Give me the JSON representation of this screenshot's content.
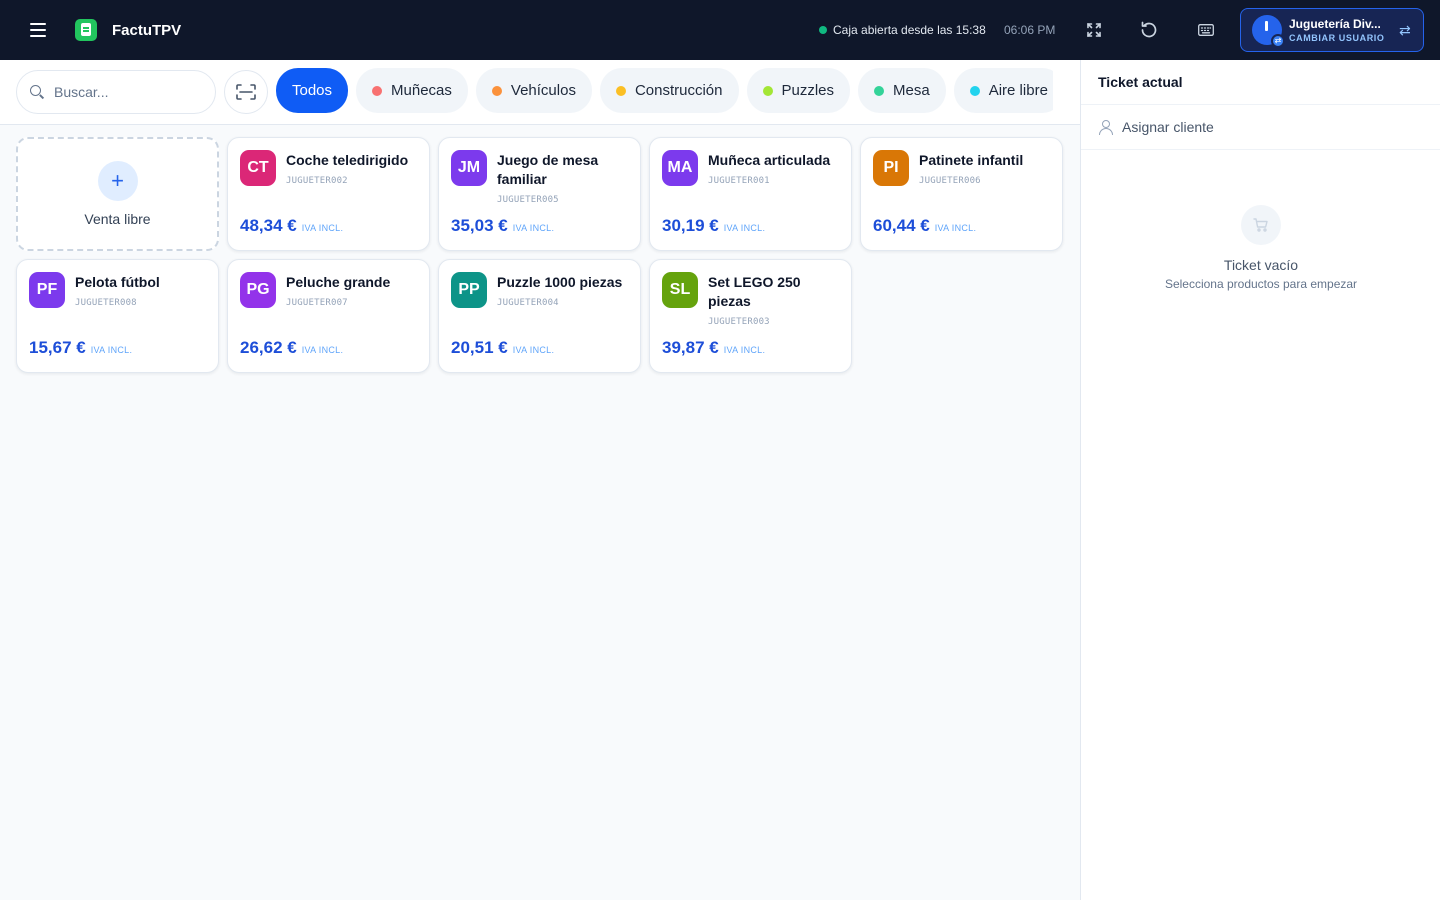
{
  "header": {
    "app_title": "FactuTPV",
    "status_text": "Caja abierta desde las 15:38",
    "clock": "06:06 PM",
    "user_name": "Juguetería Div...",
    "user_action": "CAMBIAR USUARIO",
    "icons": [
      "menu-icon",
      "fullscreen-icon",
      "refresh-icon",
      "keyboard-icon",
      "swap-icon"
    ]
  },
  "search": {
    "placeholder": "Buscar..."
  },
  "categories": [
    {
      "label": "Todos",
      "active": true,
      "color": ""
    },
    {
      "label": "Muñecas",
      "active": false,
      "color": "#f87171"
    },
    {
      "label": "Vehículos",
      "active": false,
      "color": "#fb923c"
    },
    {
      "label": "Construcción",
      "active": false,
      "color": "#fbbf24"
    },
    {
      "label": "Puzzles",
      "active": false,
      "color": "#a3e635"
    },
    {
      "label": "Mesa",
      "active": false,
      "color": "#34d399"
    },
    {
      "label": "Aire libre",
      "active": false,
      "color": "#22d3ee"
    }
  ],
  "free_sale": {
    "label": "Venta libre"
  },
  "products": [
    {
      "initials": "CT",
      "name": "Coche teledirigido",
      "code": "JUGUETER002",
      "price": "48,34 €",
      "tax": "IVA INCL.",
      "color": "#db2777"
    },
    {
      "initials": "JM",
      "name": "Juego de mesa familiar",
      "code": "JUGUETER005",
      "price": "35,03 €",
      "tax": "IVA INCL.",
      "color": "#7c3aed"
    },
    {
      "initials": "MA",
      "name": "Muñeca articulada",
      "code": "JUGUETER001",
      "price": "30,19 €",
      "tax": "IVA INCL.",
      "color": "#7c3aed"
    },
    {
      "initials": "PI",
      "name": "Patinete infantil",
      "code": "JUGUETER006",
      "price": "60,44 €",
      "tax": "IVA INCL.",
      "color": "#d97706"
    },
    {
      "initials": "PF",
      "name": "Pelota fútbol",
      "code": "JUGUETER008",
      "price": "15,67 €",
      "tax": "IVA INCL.",
      "color": "#7c3aed"
    },
    {
      "initials": "PG",
      "name": "Peluche grande",
      "code": "JUGUETER007",
      "price": "26,62 €",
      "tax": "IVA INCL.",
      "color": "#9333ea"
    },
    {
      "initials": "PP",
      "name": "Puzzle 1000 piezas",
      "code": "JUGUETER004",
      "price": "20,51 €",
      "tax": "IVA INCL.",
      "color": "#0d9488"
    },
    {
      "initials": "SL",
      "name": "Set LEGO 250 piezas",
      "code": "JUGUETER003",
      "price": "39,87 €",
      "tax": "IVA INCL.",
      "color": "#65a30d"
    }
  ],
  "ticket": {
    "title": "Ticket actual",
    "assign_label": "Asignar cliente",
    "empty_title": "Ticket vacío",
    "empty_subtitle": "Selecciona productos para empezar"
  }
}
